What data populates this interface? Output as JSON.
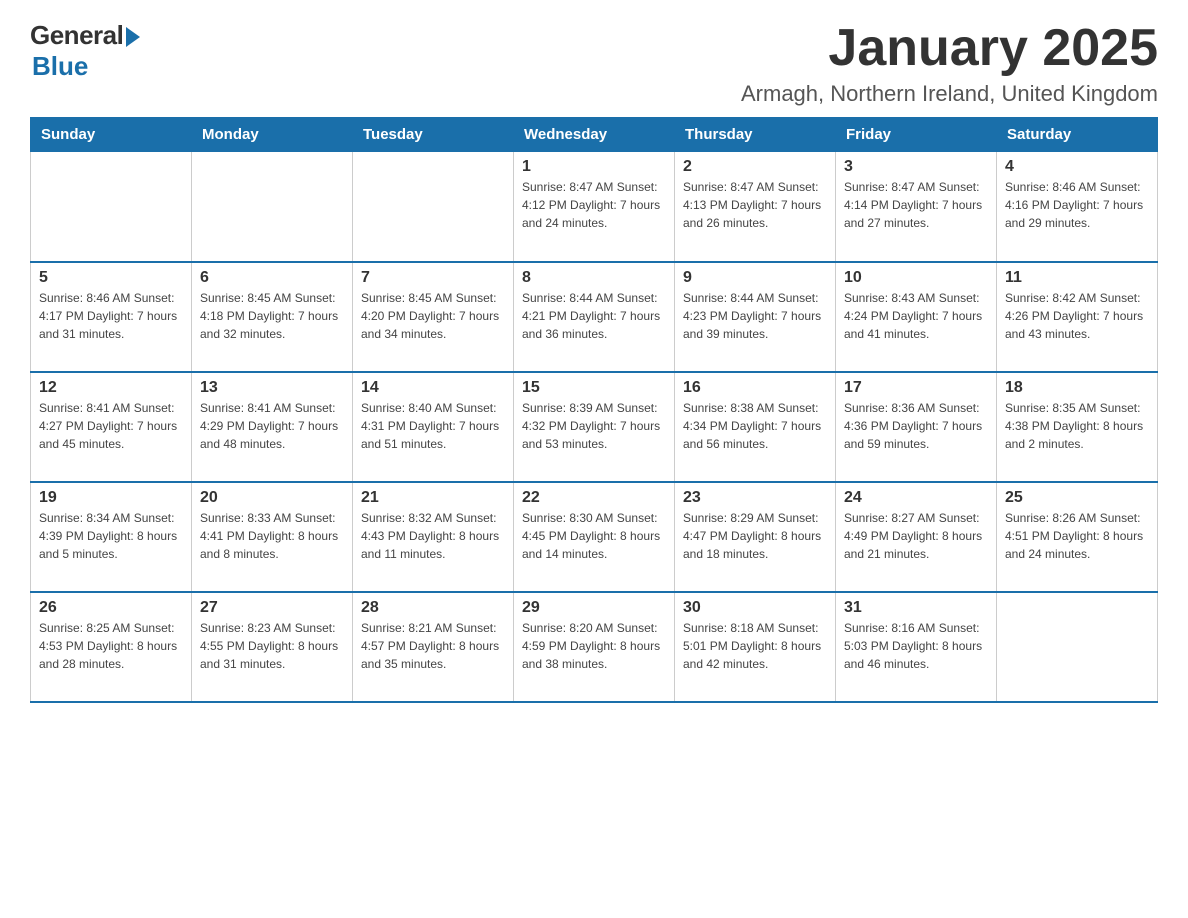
{
  "header": {
    "logo_general": "General",
    "logo_blue": "Blue",
    "month_title": "January 2025",
    "subtitle": "Armagh, Northern Ireland, United Kingdom"
  },
  "days_of_week": [
    "Sunday",
    "Monday",
    "Tuesday",
    "Wednesday",
    "Thursday",
    "Friday",
    "Saturday"
  ],
  "weeks": [
    [
      {
        "day": "",
        "info": ""
      },
      {
        "day": "",
        "info": ""
      },
      {
        "day": "",
        "info": ""
      },
      {
        "day": "1",
        "info": "Sunrise: 8:47 AM\nSunset: 4:12 PM\nDaylight: 7 hours\nand 24 minutes."
      },
      {
        "day": "2",
        "info": "Sunrise: 8:47 AM\nSunset: 4:13 PM\nDaylight: 7 hours\nand 26 minutes."
      },
      {
        "day": "3",
        "info": "Sunrise: 8:47 AM\nSunset: 4:14 PM\nDaylight: 7 hours\nand 27 minutes."
      },
      {
        "day": "4",
        "info": "Sunrise: 8:46 AM\nSunset: 4:16 PM\nDaylight: 7 hours\nand 29 minutes."
      }
    ],
    [
      {
        "day": "5",
        "info": "Sunrise: 8:46 AM\nSunset: 4:17 PM\nDaylight: 7 hours\nand 31 minutes."
      },
      {
        "day": "6",
        "info": "Sunrise: 8:45 AM\nSunset: 4:18 PM\nDaylight: 7 hours\nand 32 minutes."
      },
      {
        "day": "7",
        "info": "Sunrise: 8:45 AM\nSunset: 4:20 PM\nDaylight: 7 hours\nand 34 minutes."
      },
      {
        "day": "8",
        "info": "Sunrise: 8:44 AM\nSunset: 4:21 PM\nDaylight: 7 hours\nand 36 minutes."
      },
      {
        "day": "9",
        "info": "Sunrise: 8:44 AM\nSunset: 4:23 PM\nDaylight: 7 hours\nand 39 minutes."
      },
      {
        "day": "10",
        "info": "Sunrise: 8:43 AM\nSunset: 4:24 PM\nDaylight: 7 hours\nand 41 minutes."
      },
      {
        "day": "11",
        "info": "Sunrise: 8:42 AM\nSunset: 4:26 PM\nDaylight: 7 hours\nand 43 minutes."
      }
    ],
    [
      {
        "day": "12",
        "info": "Sunrise: 8:41 AM\nSunset: 4:27 PM\nDaylight: 7 hours\nand 45 minutes."
      },
      {
        "day": "13",
        "info": "Sunrise: 8:41 AM\nSunset: 4:29 PM\nDaylight: 7 hours\nand 48 minutes."
      },
      {
        "day": "14",
        "info": "Sunrise: 8:40 AM\nSunset: 4:31 PM\nDaylight: 7 hours\nand 51 minutes."
      },
      {
        "day": "15",
        "info": "Sunrise: 8:39 AM\nSunset: 4:32 PM\nDaylight: 7 hours\nand 53 minutes."
      },
      {
        "day": "16",
        "info": "Sunrise: 8:38 AM\nSunset: 4:34 PM\nDaylight: 7 hours\nand 56 minutes."
      },
      {
        "day": "17",
        "info": "Sunrise: 8:36 AM\nSunset: 4:36 PM\nDaylight: 7 hours\nand 59 minutes."
      },
      {
        "day": "18",
        "info": "Sunrise: 8:35 AM\nSunset: 4:38 PM\nDaylight: 8 hours\nand 2 minutes."
      }
    ],
    [
      {
        "day": "19",
        "info": "Sunrise: 8:34 AM\nSunset: 4:39 PM\nDaylight: 8 hours\nand 5 minutes."
      },
      {
        "day": "20",
        "info": "Sunrise: 8:33 AM\nSunset: 4:41 PM\nDaylight: 8 hours\nand 8 minutes."
      },
      {
        "day": "21",
        "info": "Sunrise: 8:32 AM\nSunset: 4:43 PM\nDaylight: 8 hours\nand 11 minutes."
      },
      {
        "day": "22",
        "info": "Sunrise: 8:30 AM\nSunset: 4:45 PM\nDaylight: 8 hours\nand 14 minutes."
      },
      {
        "day": "23",
        "info": "Sunrise: 8:29 AM\nSunset: 4:47 PM\nDaylight: 8 hours\nand 18 minutes."
      },
      {
        "day": "24",
        "info": "Sunrise: 8:27 AM\nSunset: 4:49 PM\nDaylight: 8 hours\nand 21 minutes."
      },
      {
        "day": "25",
        "info": "Sunrise: 8:26 AM\nSunset: 4:51 PM\nDaylight: 8 hours\nand 24 minutes."
      }
    ],
    [
      {
        "day": "26",
        "info": "Sunrise: 8:25 AM\nSunset: 4:53 PM\nDaylight: 8 hours\nand 28 minutes."
      },
      {
        "day": "27",
        "info": "Sunrise: 8:23 AM\nSunset: 4:55 PM\nDaylight: 8 hours\nand 31 minutes."
      },
      {
        "day": "28",
        "info": "Sunrise: 8:21 AM\nSunset: 4:57 PM\nDaylight: 8 hours\nand 35 minutes."
      },
      {
        "day": "29",
        "info": "Sunrise: 8:20 AM\nSunset: 4:59 PM\nDaylight: 8 hours\nand 38 minutes."
      },
      {
        "day": "30",
        "info": "Sunrise: 8:18 AM\nSunset: 5:01 PM\nDaylight: 8 hours\nand 42 minutes."
      },
      {
        "day": "31",
        "info": "Sunrise: 8:16 AM\nSunset: 5:03 PM\nDaylight: 8 hours\nand 46 minutes."
      },
      {
        "day": "",
        "info": ""
      }
    ]
  ]
}
